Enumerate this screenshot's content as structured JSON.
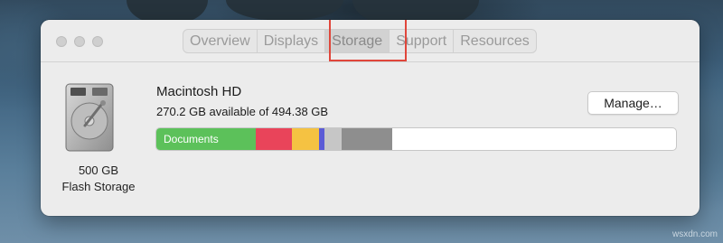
{
  "window": {
    "tabs": [
      {
        "label": "Overview",
        "selected": false
      },
      {
        "label": "Displays",
        "selected": false
      },
      {
        "label": "Storage",
        "selected": true
      },
      {
        "label": "Support",
        "selected": false
      },
      {
        "label": "Resources",
        "selected": false
      }
    ]
  },
  "disk": {
    "icon": "hard-drive-icon",
    "name": "Macintosh HD",
    "available_text": "270.2 GB available of 494.38 GB",
    "capacity_line1": "500 GB",
    "capacity_line2": "Flash Storage",
    "manage_label": "Manage…"
  },
  "storage_bar": {
    "segments": [
      {
        "label": "Documents",
        "color": "#5cc15a",
        "fraction": 0.191
      },
      {
        "label": "",
        "color": "#e9445a",
        "fraction": 0.069
      },
      {
        "label": "",
        "color": "#f5c242",
        "fraction": 0.052
      },
      {
        "label": "",
        "color": "#5b5bd6",
        "fraction": 0.01
      },
      {
        "label": "",
        "color": "#c6c6c6",
        "fraction": 0.033
      },
      {
        "label": "",
        "color": "#8e8e8e",
        "fraction": 0.097
      }
    ]
  },
  "watermark": "wsxdn.com"
}
